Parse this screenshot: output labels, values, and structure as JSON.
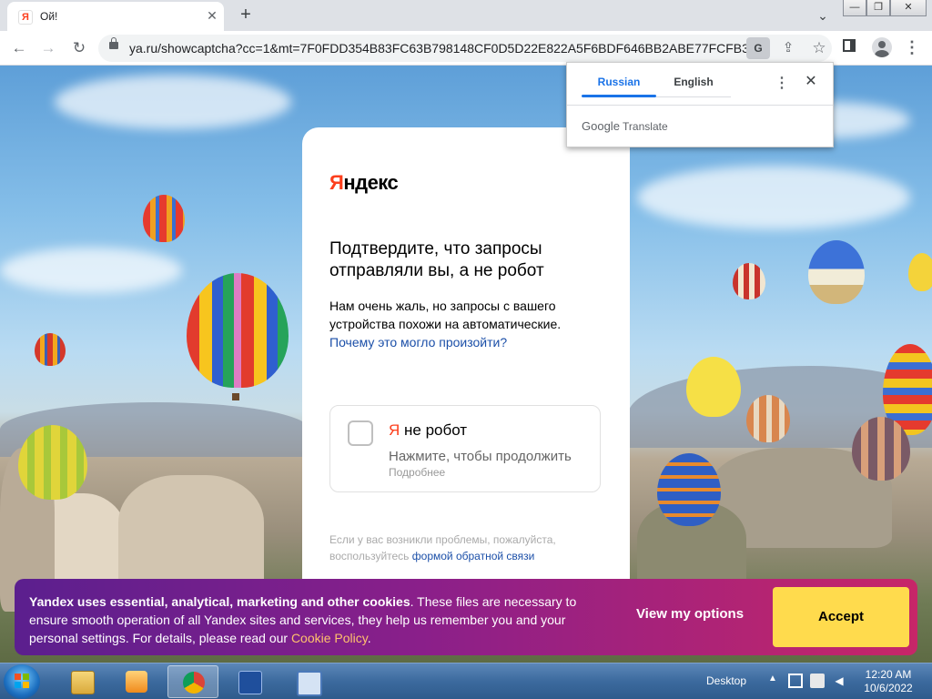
{
  "browser": {
    "tab_title": "Ой!",
    "tab_favicon_glyph": "Я",
    "tab_close": "✕",
    "new_tab": "+",
    "tab_dropdown": "⌄",
    "window_buttons": {
      "minimize": "—",
      "restore": "❐",
      "close": "✕"
    },
    "nav": {
      "back": "←",
      "forward": "→",
      "reload": "↻"
    },
    "url": "ya.ru/showcaptcha?cc=1&mt=7F0FDD354B83FC63B798148CF0D5D22E822A5F6BDF646BB2ABE77FCFB320...",
    "translate_glyph": "G",
    "share_glyph": "⇪",
    "star_glyph": "☆",
    "menu_glyph": "⋮"
  },
  "translate_popup": {
    "lang_source": "Russian",
    "lang_target": "English",
    "more_glyph": "⋮",
    "close_glyph": "✕",
    "google": "Google",
    "translate": "Translate"
  },
  "captcha": {
    "logo_ya": "Я",
    "logo_rest": "ндекс",
    "title": "Подтвердите, что запросы отправляли вы, а не робот",
    "desc": "Нам очень жаль, но запросы с вашего устройства похожи на автоматические.",
    "desc_link": "Почему это могло произойти?",
    "robot_ya": "Я",
    "robot_rest": " не робот",
    "hint": "Нажмите, чтобы продолжить",
    "more": "Подробнее",
    "problem_text": "Если у вас возникли проблемы, пожалуйста, воспользуйтесь",
    "problem_link": "формой обратной связи"
  },
  "cookie": {
    "bold_text": "Yandex uses essential, analytical, marketing and other cookies",
    "text": ". These files are necessary to ensure smooth operation of all Yandex sites and services, they help us remember you and your personal settings. For details, please read our ",
    "link": "Cookie Policy",
    "end": ".",
    "view_options": "View my options",
    "accept": "Accept"
  },
  "taskbar": {
    "desktop": "Desktop",
    "tray_up": "▲",
    "time": "12:20 AM",
    "date": "10/6/2022"
  },
  "colors": {
    "yandex_red": "#fc3f1d",
    "link_blue": "#1b4fa8",
    "accept_yellow": "#ffdb4d",
    "banner_start": "#5b1f8e",
    "banner_end": "#c72668"
  }
}
